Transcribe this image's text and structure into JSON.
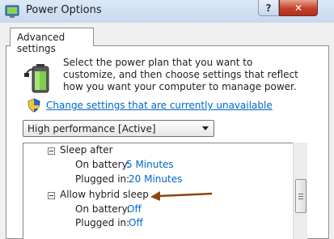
{
  "window": {
    "title": "Power Options",
    "help_label": "?",
    "close_label": "✕"
  },
  "tabs": [
    {
      "label": "Advanced settings"
    }
  ],
  "description": "Select the power plan that you want to customize, and then choose settings that reflect how you want your computer to manage power.",
  "change_settings_link": "Change settings that are currently unavailable",
  "plan_select": {
    "value": "High performance [Active]"
  },
  "settings": {
    "sleep_after": {
      "label": "Sleep after",
      "on_battery_label": "On battery:",
      "on_battery_value": "5 Minutes",
      "plugged_in_label": "Plugged in:",
      "plugged_in_value": "20 Minutes"
    },
    "hybrid_sleep": {
      "label": "Allow hybrid sleep",
      "on_battery_label": "On battery:",
      "on_battery_value": "Off",
      "plugged_in_label": "Plugged in:",
      "plugged_in_value": "Off"
    }
  },
  "colors": {
    "link": "#0066cc",
    "annotation_arrow": "#8b4513",
    "close_button": "#c6402a"
  },
  "icons": [
    "power-options-icon",
    "help-icon",
    "close-icon",
    "battery-plug-icon",
    "uac-shield-icon",
    "dropdown-arrow-icon",
    "collapse-icon",
    "scrollbar-grip-icon",
    "annotation-arrow-icon"
  ]
}
